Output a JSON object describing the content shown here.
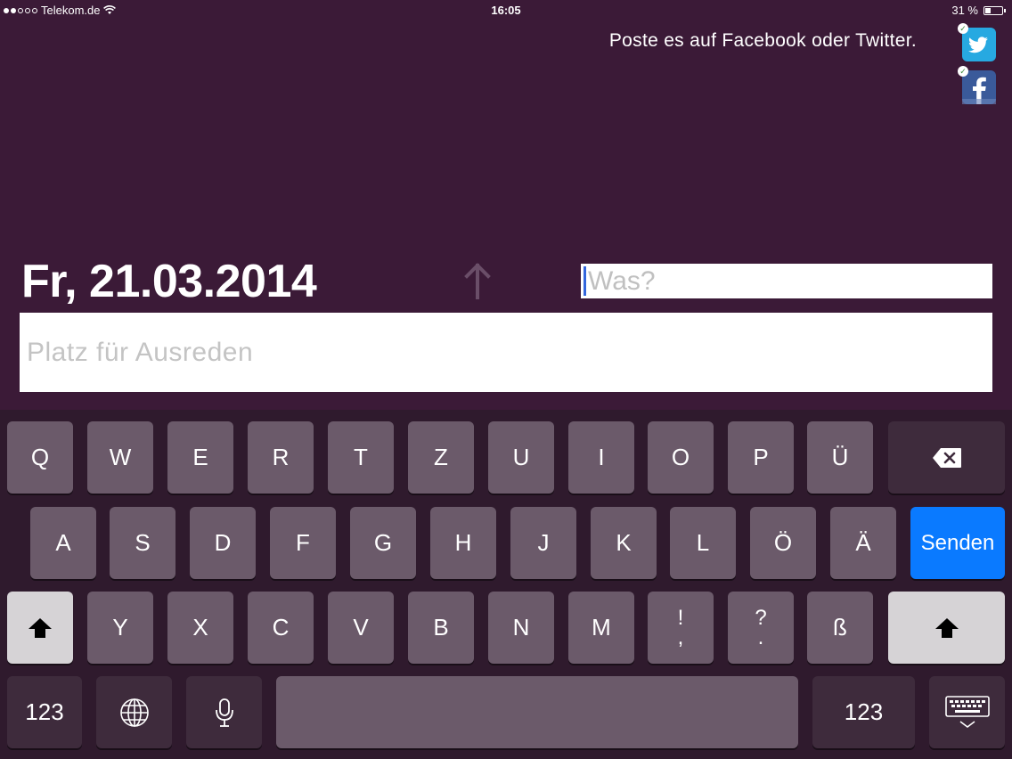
{
  "status_bar": {
    "carrier": "Telekom.de",
    "time": "16:05",
    "battery_text": "31 %",
    "battery_level": 0.31
  },
  "share": {
    "text": "Poste es auf Facebook oder Twitter."
  },
  "date": "Fr, 21.03.2014",
  "inputs": {
    "what_placeholder": "Was?",
    "excuse_placeholder": "Platz für Ausreden"
  },
  "keyboard": {
    "row1": [
      "Q",
      "W",
      "E",
      "R",
      "T",
      "Z",
      "U",
      "I",
      "O",
      "P",
      "Ü"
    ],
    "row2": [
      "A",
      "S",
      "D",
      "F",
      "G",
      "H",
      "J",
      "K",
      "L",
      "Ö",
      "Ä"
    ],
    "row3": [
      "Y",
      "X",
      "C",
      "V",
      "B",
      "N",
      "M"
    ],
    "punct1_top": "!",
    "punct1_bottom": ",",
    "punct2_top": "?",
    "punct2_bottom": ".",
    "eszett": "ß",
    "send_label": "Senden",
    "numbers_label": "123"
  },
  "colors": {
    "background": "#3b1a37",
    "send_key": "#0a7aff",
    "twitter": "#27a9e1",
    "facebook": "#3a5a9a"
  }
}
